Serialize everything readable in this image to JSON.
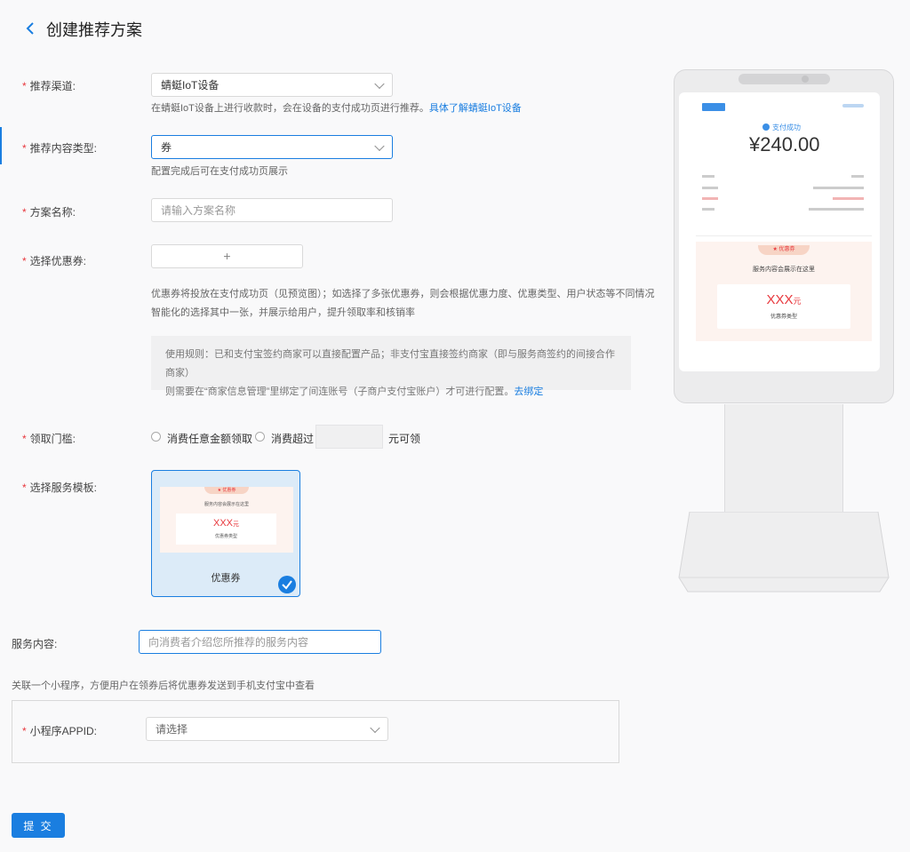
{
  "header": {
    "title": "创建推荐方案",
    "back_icon": "chevron-left-icon"
  },
  "form": {
    "channel": {
      "label": "推荐渠道:",
      "value": "蜻蜓IoT设备",
      "hint": "在蜻蜓IoT设备上进行收款时，会在设备的支付成功页进行推荐。",
      "hint_link": "具体了解蜻蜓IoT设备"
    },
    "content_type": {
      "label": "推荐内容类型:",
      "value": "券",
      "hint": "配置完成后可在支付成功页展示"
    },
    "plan_name": {
      "label": "方案名称:",
      "placeholder": "请输入方案名称"
    },
    "coupon": {
      "label": "选择优惠券:",
      "add_symbol": "+",
      "desc_line1": "优惠券将投放在支付成功页（见预览图）；如选择了多张优惠券，则会根据优惠力度、优惠类型、用户状态等不同情况",
      "desc_line2": "智能化的选择其中一张，并展示给用户，提升领取率和核销率",
      "rule_line1": "使用规则：已和支付宝签约商家可以直接配置产品；非支付宝直接签约商家（即与服务商签约的间接合作商家）",
      "rule_line2": "则需要在“商家信息管理”里绑定了间连账号（子商户支付宝账户）才可进行配置。",
      "rule_link": "去绑定"
    },
    "threshold": {
      "label": "领取门槛:",
      "option1": "消费任意金额领取",
      "option2": "消费超过",
      "suffix": "元可领"
    },
    "template": {
      "label": "选择服务模板:",
      "card_name": "优惠券",
      "thumb_banner": "★ 优惠券",
      "thumb_title": "服务内容会展示在这里",
      "thumb_amount": "XXX",
      "thumb_unit": "元",
      "thumb_type": "优惠券类型"
    },
    "service_content": {
      "label": "服务内容:",
      "placeholder": "向消费者介绍您所推荐的服务内容"
    },
    "mini_program": {
      "intro": "关联一个小程序，方便用户在领券后将优惠券发送到手机支付宝中查看",
      "label": "小程序APPID:",
      "placeholder": "请选择"
    },
    "submit_label": "提 交",
    "required_mark": "*"
  },
  "preview": {
    "status": "支付成功",
    "amount": "¥240.00",
    "coupon_banner": "★ 优惠券",
    "coupon_title": "服务内容会展示在这里",
    "coupon_amount": "XXX",
    "coupon_unit": "元",
    "coupon_type": "优惠券类型"
  },
  "colors": {
    "accent": "#1a7ee0",
    "required": "#e8383d",
    "coupon_red": "#e8383d"
  }
}
